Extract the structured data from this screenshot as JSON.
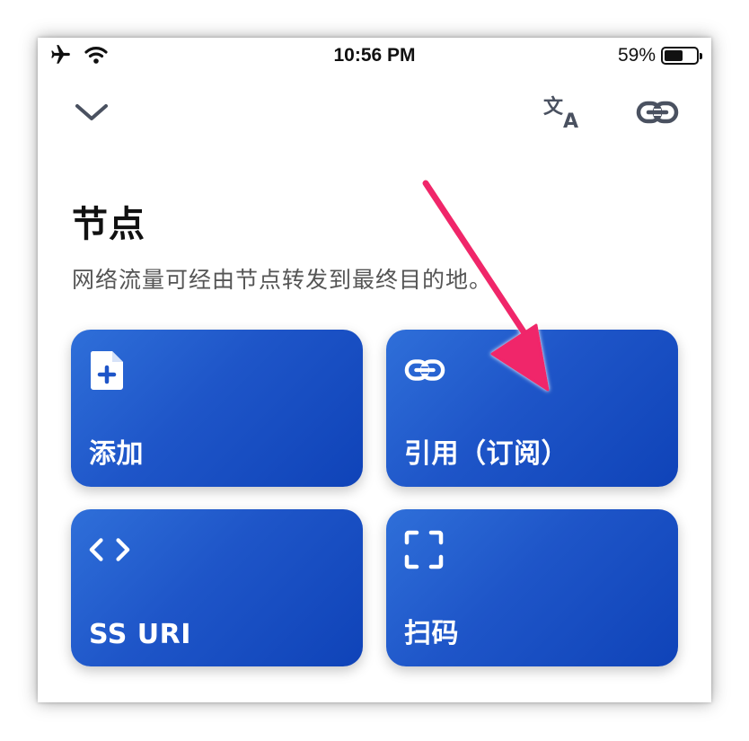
{
  "status_bar": {
    "time": "10:56 PM",
    "battery_percent": "59%",
    "battery_level": 0.59,
    "icons": [
      "airplane-icon",
      "wifi-icon",
      "battery-icon"
    ]
  },
  "nav": {
    "left_icon": "chevron-down-icon",
    "right_icons": [
      "translate-icon",
      "link-icon"
    ]
  },
  "page": {
    "title": "节点",
    "subtitle": "网络流量可经由节点转发到最终目的地。"
  },
  "cards": [
    {
      "label": "添加",
      "icon": "file-add-icon"
    },
    {
      "label": "引用（订阅）",
      "icon": "link-icon"
    },
    {
      "label": "SS URI",
      "icon": "code-icon"
    },
    {
      "label": "扫码",
      "icon": "scan-icon"
    }
  ],
  "colors": {
    "card_gradient_start": "#2f6fd9",
    "card_gradient_end": "#0f43b8",
    "annotation_arrow": "#f0256b",
    "nav_icon": "#4a5160"
  }
}
